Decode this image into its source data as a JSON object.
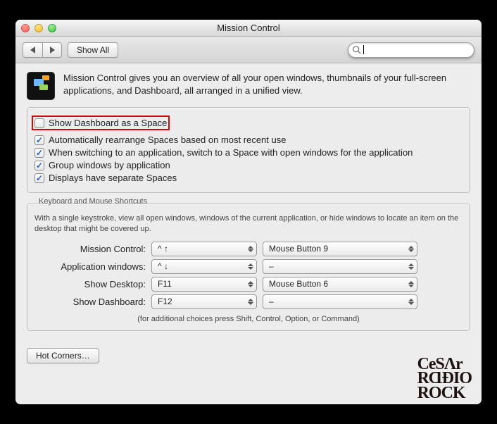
{
  "window": {
    "title": "Mission Control"
  },
  "toolbar": {
    "show_all": "Show All",
    "search_placeholder": ""
  },
  "intro": {
    "text": "Mission Control gives you an overview of all your open windows, thumbnails of your full-screen applications, and Dashboard, all arranged in a unified view."
  },
  "options": [
    {
      "label": "Show Dashboard as a Space",
      "checked": false,
      "highlighted": true
    },
    {
      "label": "Automatically rearrange Spaces based on most recent use",
      "checked": true
    },
    {
      "label": "When switching to an application, switch to a Space with open windows for the application",
      "checked": true
    },
    {
      "label": "Group windows by application",
      "checked": true
    },
    {
      "label": "Displays have separate Spaces",
      "checked": true
    }
  ],
  "shortcuts": {
    "legend": "Keyboard and Mouse Shortcuts",
    "hint": "With a single keystroke, view all open windows, windows of the current application, or hide windows to locate an item on the desktop that might be covered up.",
    "rows": [
      {
        "label": "Mission Control:",
        "key": "^ ↑",
        "mouse": "Mouse Button 9"
      },
      {
        "label": "Application windows:",
        "key": "^ ↓",
        "mouse": "–"
      },
      {
        "label": "Show Desktop:",
        "key": "F11",
        "mouse": "Mouse Button 6"
      },
      {
        "label": "Show Dashboard:",
        "key": "F12",
        "mouse": "–"
      }
    ],
    "footnote": "(for additional choices press Shift, Control, Option, or Command)"
  },
  "hot_corners": "Hot Corners…",
  "watermark": {
    "l1": "CeSɅr",
    "l2": "RⱭĐIO",
    "l3": "ROCK"
  }
}
